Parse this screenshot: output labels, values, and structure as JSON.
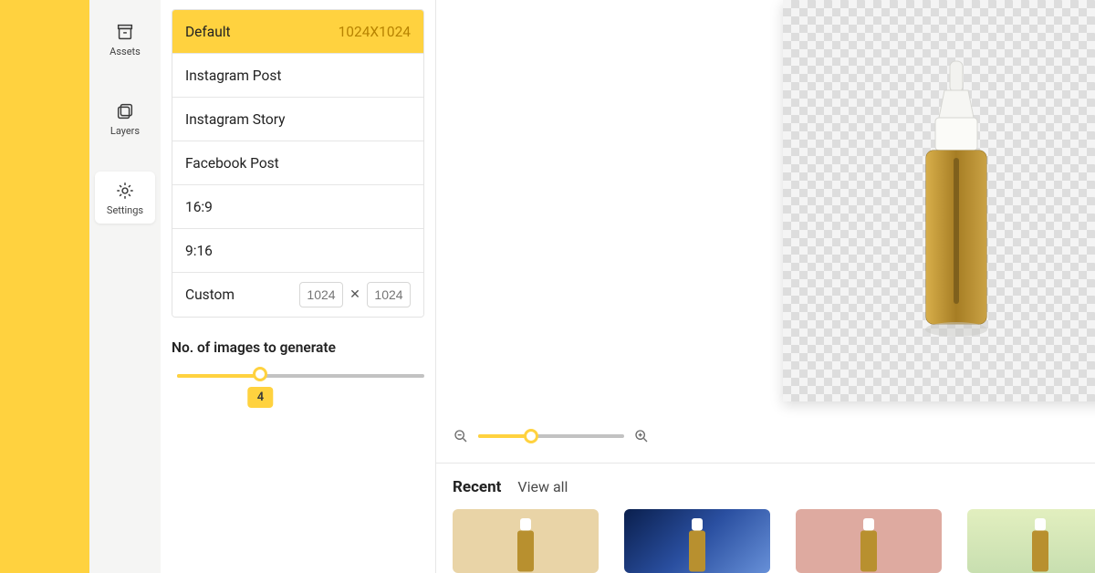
{
  "rail": {
    "assets": "Assets",
    "layers": "Layers",
    "settings": "Settings"
  },
  "canvas_presets": {
    "active_index": 0,
    "items": [
      {
        "label": "Default",
        "dimensions": "1024X1024"
      },
      {
        "label": "Instagram Post"
      },
      {
        "label": "Instagram Story"
      },
      {
        "label": "Facebook Post"
      },
      {
        "label": "16:9"
      },
      {
        "label": "9:16"
      }
    ],
    "custom": {
      "label": "Custom",
      "width": "1024",
      "height": "1024",
      "times": "✕"
    }
  },
  "generate": {
    "title": "No. of images to generate",
    "value": "4",
    "percent": 33
  },
  "zoom": {
    "percent": 36
  },
  "recent": {
    "active_label": "Recent",
    "view_all": "View all",
    "thumbs": [
      "beige",
      "blue-marble",
      "pink",
      "green"
    ]
  }
}
